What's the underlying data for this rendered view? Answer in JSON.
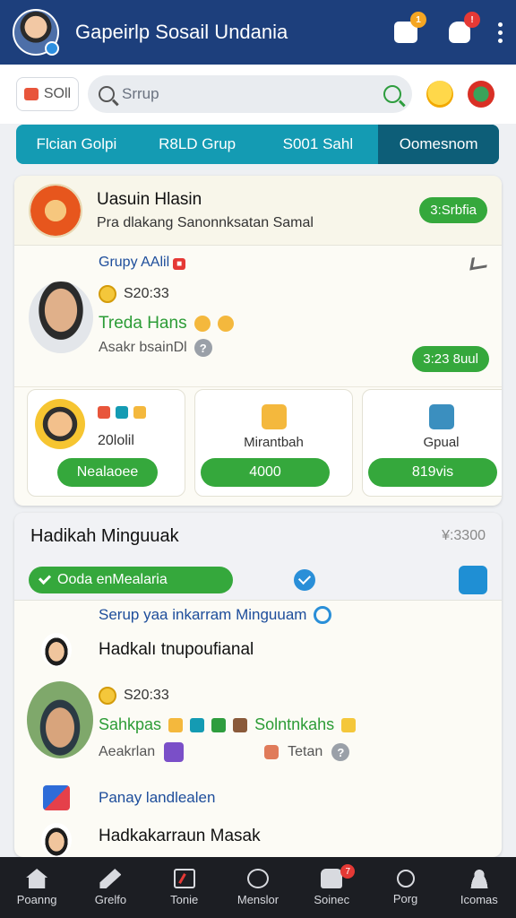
{
  "header": {
    "title": "Gapeirlp Sosail Undania",
    "inbox_badge": "1",
    "bag_badge": "!"
  },
  "search": {
    "chip_label": "SOll",
    "placeholder": "Srrup"
  },
  "tabs": [
    {
      "label": "Flcian Golpi",
      "active": false
    },
    {
      "label": "R8LD Grup",
      "active": false
    },
    {
      "label": "S001 Sahl",
      "active": false
    },
    {
      "label": "Oomesnom",
      "active": true
    }
  ],
  "featured": {
    "title": "Uasuin Hlasin",
    "subtitle": "Pra dlakang Sanonnksatan Samal",
    "status_pill": "3:Srbfia",
    "post": {
      "group_label": "Grupy AAlil",
      "time": "S20:33",
      "name": "Treda Hans",
      "location": "Asakr bsainDl",
      "action_pill": "3:23 8uul"
    },
    "tiles": [
      {
        "count": "20lolil",
        "button": "Nealaoee"
      },
      {
        "label": "Mirantbah",
        "button": "4000"
      },
      {
        "label": "Gpual",
        "button": "819vis"
      }
    ]
  },
  "feed": {
    "title": "Hadikah Minguuak",
    "price": "¥:3300",
    "filter_label": "Ooda enMealaria",
    "items": [
      {
        "group": "Serup yaa inkarram Minguuam",
        "text": "Hadkalı tnupoufianal"
      },
      {
        "time": "S20:33",
        "name": "Sahkpas",
        "name2": "Solntnkahs",
        "sub1": "Aeakrlan",
        "sub2": "Tetan"
      },
      {
        "group": "Panay landlealen",
        "text": "Hadkakarraun Masak"
      }
    ]
  },
  "bottom_nav": [
    {
      "label": "Poanng",
      "icon": "home-icon"
    },
    {
      "label": "Grelfo",
      "icon": "pen-icon"
    },
    {
      "label": "Tonie",
      "icon": "document-icon"
    },
    {
      "label": "Menslor",
      "icon": "clock-icon"
    },
    {
      "label": "Soinec",
      "icon": "phone-icon",
      "badge": "7"
    },
    {
      "label": "Porg",
      "icon": "search-icon"
    },
    {
      "label": "Icomas",
      "icon": "user-icon"
    }
  ]
}
